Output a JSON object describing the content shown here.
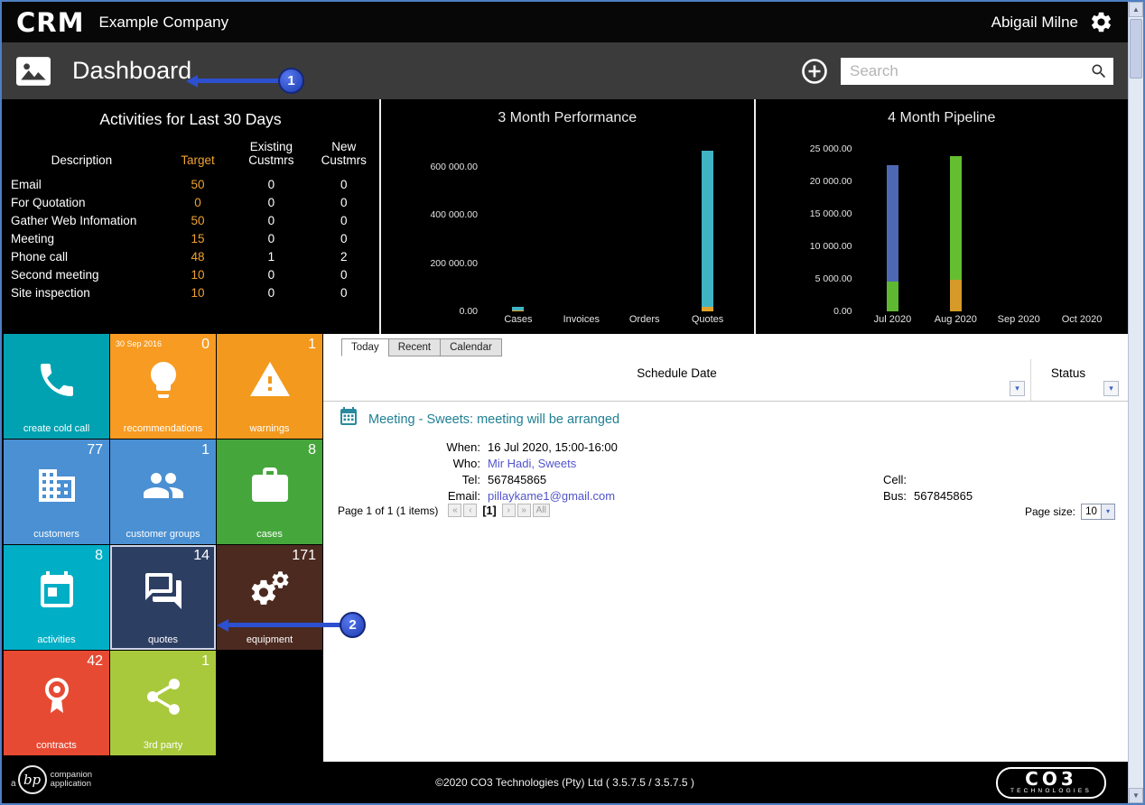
{
  "icons": {
    "gear": "⚙",
    "dropdown": "▾",
    "scroll_up": "▲",
    "scroll_down": "▼"
  },
  "colors": {
    "accent_orange": "#f0a232",
    "link_blue": "#5254cd",
    "meeting_title_teal": "#1e7f93",
    "annotation_blue": "#2c50cf"
  },
  "titlebar": {
    "logo": "CRM",
    "company": "Example Company",
    "user": "Abigail Milne"
  },
  "nav": {
    "title": "Dashboard",
    "search_placeholder": "Search"
  },
  "annotations": {
    "step1": "1",
    "step2": "2"
  },
  "activities": {
    "title": "Activities for Last 30 Days",
    "columns": [
      "Description",
      "Target",
      "Existing Custmrs",
      "New Custmrs"
    ],
    "rows": [
      {
        "desc": "Email",
        "target": "50",
        "existing": "0",
        "newc": "0"
      },
      {
        "desc": "For Quotation",
        "target": "0",
        "existing": "0",
        "newc": "0"
      },
      {
        "desc": "Gather Web Infomation",
        "target": "50",
        "existing": "0",
        "newc": "0"
      },
      {
        "desc": "Meeting",
        "target": "15",
        "existing": "0",
        "newc": "0"
      },
      {
        "desc": "Phone call",
        "target": "48",
        "existing": "1",
        "newc": "2"
      },
      {
        "desc": "Second meeting",
        "target": "10",
        "existing": "0",
        "newc": "0"
      },
      {
        "desc": "Site inspection",
        "target": "10",
        "existing": "0",
        "newc": "0"
      }
    ]
  },
  "chart_data": [
    {
      "type": "stacked-bar",
      "title": "3 Month Performance",
      "categories": [
        "Cases",
        "Invoices",
        "Orders",
        "Quotes"
      ],
      "ymax": 700000,
      "grid": false,
      "legend": false,
      "yticks": [
        {
          "value": 0,
          "label": "0.00"
        },
        {
          "value": 200000,
          "label": "200 000.00"
        },
        {
          "value": 400000,
          "label": "400 000.00"
        },
        {
          "value": 600000,
          "label": "600 000.00"
        }
      ],
      "bars": [
        {
          "category": "Cases",
          "segments": [
            {
              "value": 4000,
              "color": "#e0a22e"
            },
            {
              "value": 14000,
              "color": "#41b4c4"
            }
          ]
        },
        {
          "category": "Invoices",
          "segments": []
        },
        {
          "category": "Orders",
          "segments": []
        },
        {
          "category": "Quotes",
          "segments": [
            {
              "value": 20000,
              "color": "#e0a22e"
            },
            {
              "value": 645000,
              "color": "#41b4c4"
            }
          ]
        }
      ]
    },
    {
      "type": "stacked-bar",
      "title": "4 Month Pipeline",
      "categories": [
        "Jul 2020",
        "Aug 2020",
        "Sep 2020",
        "Oct 2020"
      ],
      "ymax": 26000,
      "grid": false,
      "legend": false,
      "yticks": [
        {
          "value": 0,
          "label": "0.00"
        },
        {
          "value": 5000,
          "label": "5 000.00"
        },
        {
          "value": 10000,
          "label": "10 000.00"
        },
        {
          "value": 15000,
          "label": "15 000.00"
        },
        {
          "value": 20000,
          "label": "20 000.00"
        },
        {
          "value": 25000,
          "label": "25 000.00"
        }
      ],
      "bars": [
        {
          "category": "Jul 2020",
          "segments": [
            {
              "value": 4600,
              "color": "#5eb832"
            },
            {
              "value": 17900,
              "color": "#4d69b4"
            }
          ]
        },
        {
          "category": "Aug 2020",
          "segments": [
            {
              "value": 4900,
              "color": "#d59a28"
            },
            {
              "value": 19000,
              "color": "#64be30"
            }
          ]
        },
        {
          "category": "Sep 2020",
          "segments": []
        },
        {
          "category": "Oct 2020",
          "segments": []
        }
      ]
    }
  ],
  "tiles": [
    {
      "label": "create cold call",
      "badge": "",
      "color": "#00a2b2"
    },
    {
      "label": "recommendations",
      "badge": "0",
      "date": "30 Sep 2016",
      "color": "#f79b22"
    },
    {
      "label": "warnings",
      "badge": "1",
      "color": "#f2991e"
    },
    {
      "label": "customers",
      "badge": "77",
      "color": "#4a90d3"
    },
    {
      "label": "customer groups",
      "badge": "1",
      "color": "#4a90d3"
    },
    {
      "label": "cases",
      "badge": "8",
      "color": "#45a63c"
    },
    {
      "label": "activities",
      "badge": "8",
      "color": "#00aec6"
    },
    {
      "label": "quotes",
      "badge": "14",
      "color": "#2d3e63",
      "selected": true
    },
    {
      "label": "equipment",
      "badge": "171",
      "color": "#4c2a20"
    },
    {
      "label": "contracts",
      "badge": "42",
      "color": "#e74a33"
    },
    {
      "label": "3rd party",
      "badge": "1",
      "color": "#a9c93c"
    }
  ],
  "schedule": {
    "tabs": [
      {
        "label": "Today"
      },
      {
        "label": "Recent"
      },
      {
        "label": "Calendar"
      }
    ],
    "active_tab": "Today",
    "columns": [
      {
        "label": "Schedule Date"
      },
      {
        "label": "Status"
      }
    ],
    "meeting": {
      "title": "Meeting - Sweets: meeting will be arranged",
      "when_label": "When:",
      "when": "16 Jul 2020, 15:00-16:00",
      "who_label": "Who:",
      "who": "Mir Hadi, Sweets",
      "tel_label": "Tel:",
      "tel": "567845865",
      "email_label": "Email:",
      "email": "pillaykame1@gmail.com",
      "cell_label": "Cell:",
      "cell": "",
      "bus_label": "Bus:",
      "bus": "567845865"
    },
    "pagination": {
      "summary": "Page 1 of 1 (1 items)",
      "first": "«",
      "prev": "‹",
      "current": "[1]",
      "next": "›",
      "last": "»",
      "all": "All",
      "page_size_label": "Page size:",
      "page_size": "10"
    }
  },
  "footer": {
    "copyright": "©2020 CO3 Technologies (Pty) Ltd ( 3.5.7.5 / 3.5.7.5 )",
    "left_logo": {
      "prefix": "a",
      "initials": "bp",
      "line1": "companion",
      "line2": "application"
    },
    "right_logo": {
      "name": "CO3",
      "sub": "TECHNOLOGIES"
    }
  }
}
